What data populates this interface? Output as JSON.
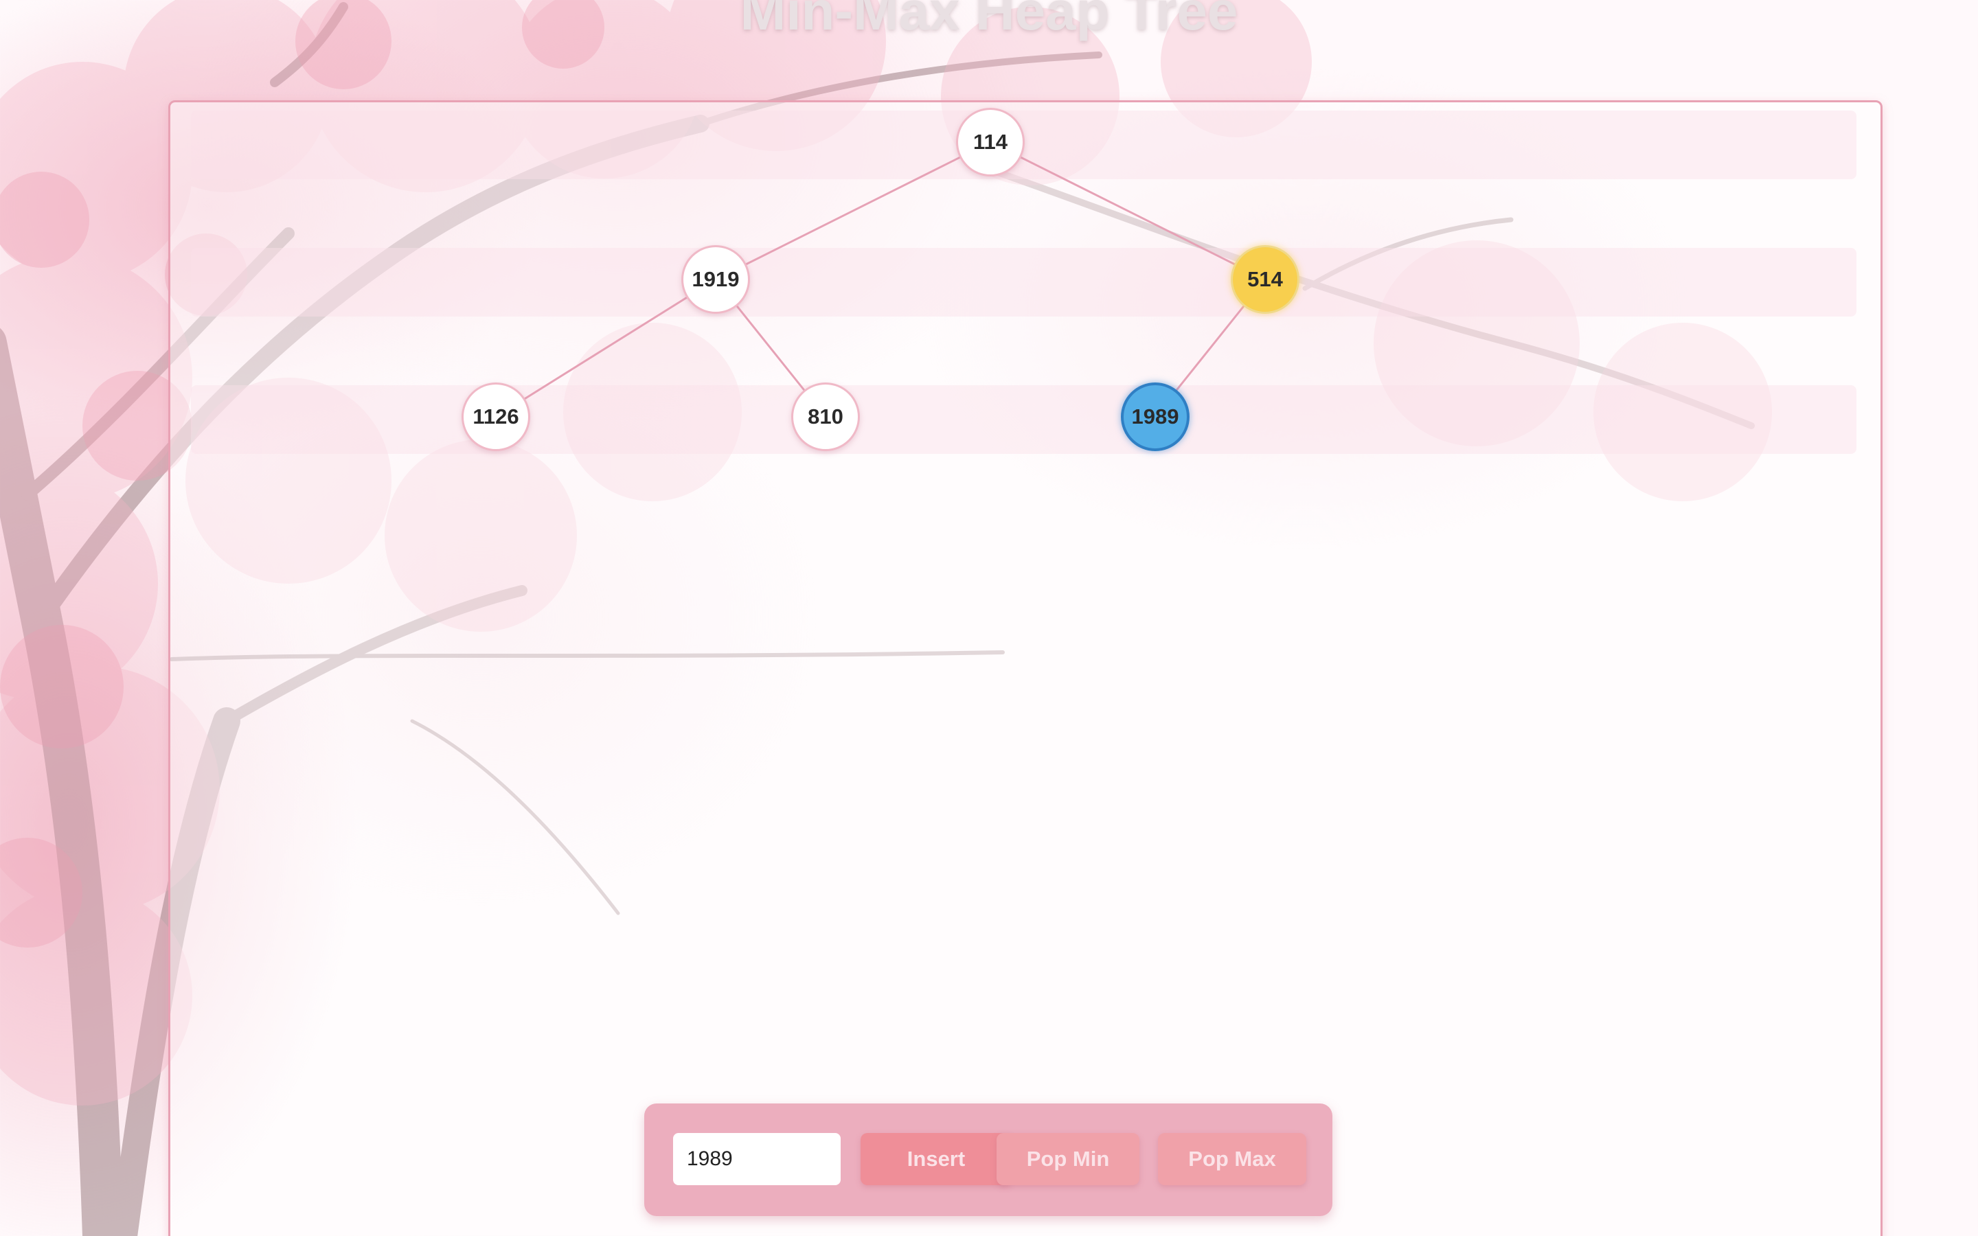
{
  "page": {
    "title": "Min-Max Heap Tree"
  },
  "colors": {
    "accent": "#ef8e98",
    "panel_border": "#e8a2b4",
    "control_bg": "#ecaebe",
    "node_fill": "#ffffff",
    "max_node": "#f8cf4e",
    "inserted_node": "#53aee7"
  },
  "heap": {
    "nodes": [
      {
        "value": "114",
        "level": 0,
        "state": "normal"
      },
      {
        "value": "1919",
        "level": 1,
        "state": "normal"
      },
      {
        "value": "514",
        "level": 1,
        "state": "max"
      },
      {
        "value": "1126",
        "level": 2,
        "state": "normal"
      },
      {
        "value": "810",
        "level": 2,
        "state": "normal"
      },
      {
        "value": "1989",
        "level": 2,
        "state": "inserted"
      }
    ],
    "edges": [
      [
        "114",
        "1919"
      ],
      [
        "114",
        "514"
      ],
      [
        "1919",
        "1126"
      ],
      [
        "1919",
        "810"
      ],
      [
        "514",
        "1989"
      ]
    ]
  },
  "controls": {
    "input_value": "1989",
    "insert_label": "Insert",
    "pop_min_label": "Pop Min",
    "pop_max_label": "Pop Max"
  }
}
